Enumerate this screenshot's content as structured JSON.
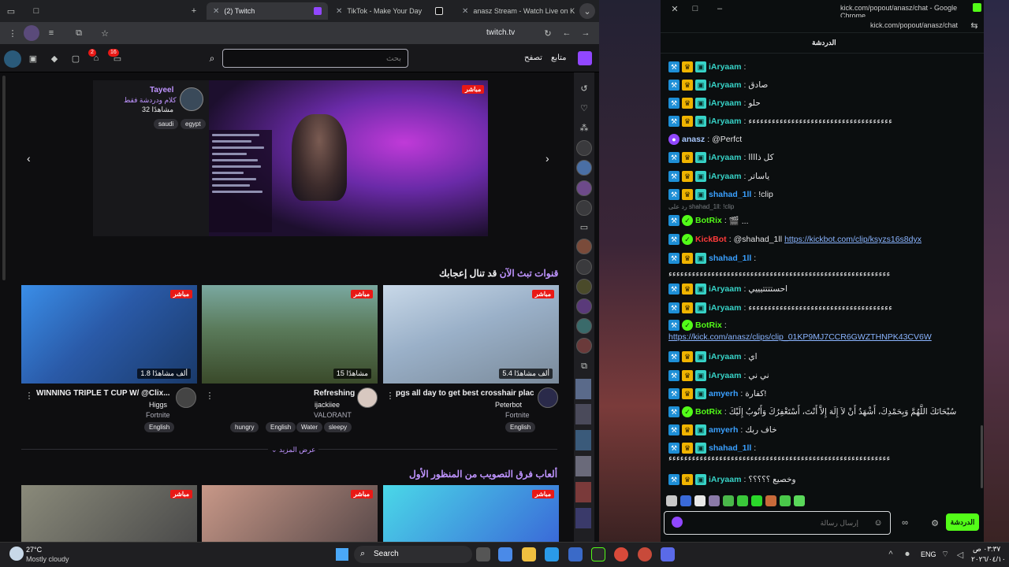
{
  "browser": {
    "tabs": [
      {
        "label": "(2) Twitch",
        "color": "#9147ff"
      },
      {
        "label": "TikTok - Make Your Day",
        "color": "#ffffff"
      },
      {
        "label": "anasz Stream - Watch Live on K",
        "color": "#53fc18"
      }
    ],
    "url": "twitch.tv"
  },
  "twitch": {
    "header": {
      "following": "متابع",
      "browse": "تصفح",
      "search_placeholder": "بحث",
      "badge_notifications": "2",
      "badge_inbox": "16"
    },
    "featured": {
      "streamer": "Tayeel",
      "title": "كلام ودردشة فقط",
      "viewers": "32 مشاهدًا",
      "tags": [
        "egypt",
        "saudi"
      ],
      "live": "مباشر"
    },
    "section1": {
      "title_prefix": "قنوات تبث الآن",
      "title_suffix": " قد تنال إعجابك"
    },
    "cards": [
      {
        "title": "WINNING TRIPLE T CUP W/ @Clix...",
        "channel": "Higgs",
        "game": "Fortnite",
        "tags": [
          "English"
        ],
        "viewers": "1.8 ألف مشاهدًا",
        "live": "مباشر"
      },
      {
        "title": "Refreshing",
        "channel": "ijackiiee",
        "game": "VALORANT",
        "tags": [
          "hungry",
          "English",
          "Water",
          "sleepy"
        ],
        "viewers": "15 مشاهدًا",
        "live": "مباشر"
      },
      {
        "title": "pgs all day to get best crosshair plac...",
        "channel": "Peterbot",
        "game": "Fortnite",
        "tags": [
          "English"
        ],
        "viewers": "5.4 ألف مشاهدًا",
        "live": "مباشر"
      }
    ],
    "show_more": "عرض المزيد",
    "section2": {
      "title": "ألعاب فرق التصويب من المنظور الأول"
    },
    "live_label": "مباشر"
  },
  "chat": {
    "window_title": "kick.com/popout/anasz/chat - Google Chrome",
    "url": "kick.com/popout/anasz/chat",
    "header": "الدردشة",
    "messages": [
      {
        "user": "iAryaam",
        "text": "",
        "color": "#37d3c7",
        "badges": [
          "mod",
          "vip",
          "og"
        ]
      },
      {
        "user": "iAryaam",
        "text": "صادق",
        "color": "#37d3c7",
        "badges": [
          "mod",
          "vip",
          "og"
        ]
      },
      {
        "user": "iAryaam",
        "text": "حلو",
        "color": "#37d3c7",
        "badges": [
          "mod",
          "vip",
          "og"
        ]
      },
      {
        "user": "iAryaam",
        "text": "ﺀﺀﺀﺀﺀﺀﺀﺀﺀﺀﺀﺀﺀﺀﺀﺀﺀﺀﺀﺀﺀﺀﺀﺀﺀﺀﺀﺀﺀﺀﺀﺀﺀﺀﺀﺀﺀ",
        "color": "#37d3c7",
        "badges": [
          "mod",
          "vip",
          "og"
        ]
      },
      {
        "user": "anasz",
        "text": "@Perfct",
        "color": "#a8c8ff",
        "badges": [
          "mic"
        ]
      },
      {
        "user": "iAryaam",
        "text": "كل ذاااا",
        "color": "#37d3c7",
        "badges": [
          "mod",
          "vip",
          "og"
        ]
      },
      {
        "user": "iAryaam",
        "text": "ياساتر",
        "color": "#37d3c7",
        "badges": [
          "mod",
          "vip",
          "og"
        ]
      },
      {
        "user": "shahad_1ll",
        "text": "!clip",
        "color": "#3aa0ff",
        "badges": [
          "mod",
          "vip",
          "og"
        ]
      },
      {
        "user": "BotRix",
        "text": "🎬 ...",
        "color": "#53fc18",
        "badges": [
          "mod",
          "bot"
        ],
        "reply": "رد على shahad_1ll: !clip"
      },
      {
        "user": "KickBot",
        "text": "@shahad_1ll",
        "link": "https://kickbot.com/clip/ksyzs16s8dyx",
        "color": "#ff3b3b",
        "badges": [
          "mod",
          "bot"
        ]
      },
      {
        "user": "shahad_1ll",
        "text": "",
        "color": "#3aa0ff",
        "badges": [
          "mod",
          "vip",
          "og"
        ]
      },
      {
        "user": "",
        "text": "ﺀﺀﺀﺀﺀﺀﺀﺀﺀﺀﺀﺀﺀﺀﺀﺀﺀﺀﺀﺀﺀﺀﺀﺀﺀﺀﺀﺀﺀﺀﺀﺀﺀﺀﺀﺀﺀﺀﺀﺀﺀﺀﺀﺀﺀﺀﺀﺀﺀﺀﺀﺀﺀﺀﺀﺀﺀ",
        "color": "#e4e4e6",
        "badges": []
      },
      {
        "user": "iAryaam",
        "text": "احستتتتيييي",
        "color": "#37d3c7",
        "badges": [
          "mod",
          "vip",
          "og"
        ]
      },
      {
        "user": "iAryaam",
        "text": "ﺀﺀﺀﺀﺀﺀﺀﺀﺀﺀﺀﺀﺀﺀﺀﺀﺀﺀﺀﺀﺀﺀﺀﺀﺀﺀﺀﺀﺀﺀﺀﺀﺀﺀﺀﺀﺀ",
        "color": "#37d3c7",
        "badges": [
          "mod",
          "vip",
          "og"
        ]
      },
      {
        "user": "BotRix",
        "text": "",
        "color": "#53fc18",
        "badges": [
          "mod",
          "bot"
        ]
      },
      {
        "user": "",
        "text": "",
        "link": "https://kick.com/anasz/clips/clip_01KP9MJ7CCR6GWZTHNPK43CV6W",
        "color": "#e4e4e6",
        "badges": []
      },
      {
        "user": "iAryaam",
        "text": "اي",
        "color": "#37d3c7",
        "badges": [
          "mod",
          "vip",
          "og"
        ]
      },
      {
        "user": "iAryaam",
        "text": "ني ني",
        "color": "#37d3c7",
        "badges": [
          "mod",
          "vip",
          "og"
        ]
      },
      {
        "user": "amyerh",
        "text": "كفارة!",
        "color": "#3aa0ff",
        "badges": [
          "mod",
          "vip",
          "og"
        ]
      },
      {
        "user": "BotRix",
        "text": "سُبْحَانَكَ اللَّهُمَّ وَبِحَمْدِكَ، أَشْهَدُ أَنْ لاَ إِلَهَ إِلاَّ أَنْتَ، أَسْتَغْفِرُكَ وَأَتُوبُ إِلَيْكَ",
        "color": "#53fc18",
        "badges": [
          "mod",
          "bot"
        ]
      },
      {
        "user": "amyerh",
        "text": "خاف ربك",
        "color": "#3aa0ff",
        "badges": [
          "mod",
          "vip",
          "og"
        ]
      },
      {
        "user": "shahad_1ll",
        "text": "",
        "color": "#3aa0ff",
        "badges": [
          "mod",
          "vip",
          "og"
        ]
      },
      {
        "user": "",
        "text": "ﺀﺀﺀﺀﺀﺀﺀﺀﺀﺀﺀﺀﺀﺀﺀﺀﺀﺀﺀﺀﺀﺀﺀﺀﺀﺀﺀﺀﺀﺀﺀﺀﺀﺀﺀﺀﺀﺀﺀﺀﺀﺀﺀﺀﺀﺀﺀﺀﺀﺀﺀﺀﺀﺀﺀﺀﺀ",
        "color": "#e4e4e6",
        "badges": []
      },
      {
        "user": "iAryaam",
        "text": "وخصيع ؟؟؟؟؟",
        "color": "#37d3c7",
        "badges": [
          "mod",
          "vip",
          "og"
        ]
      }
    ],
    "input_placeholder": "إرسال رسالة",
    "send_label": "الدردشة"
  },
  "taskbar": {
    "weather_temp": "27°C",
    "weather_desc": "Mostly cloudy",
    "search_label": "Search",
    "lang": "ENG",
    "time": "٠٣:٣٧ ص",
    "date": "٢٠٢٦/٠٤/١٠"
  }
}
